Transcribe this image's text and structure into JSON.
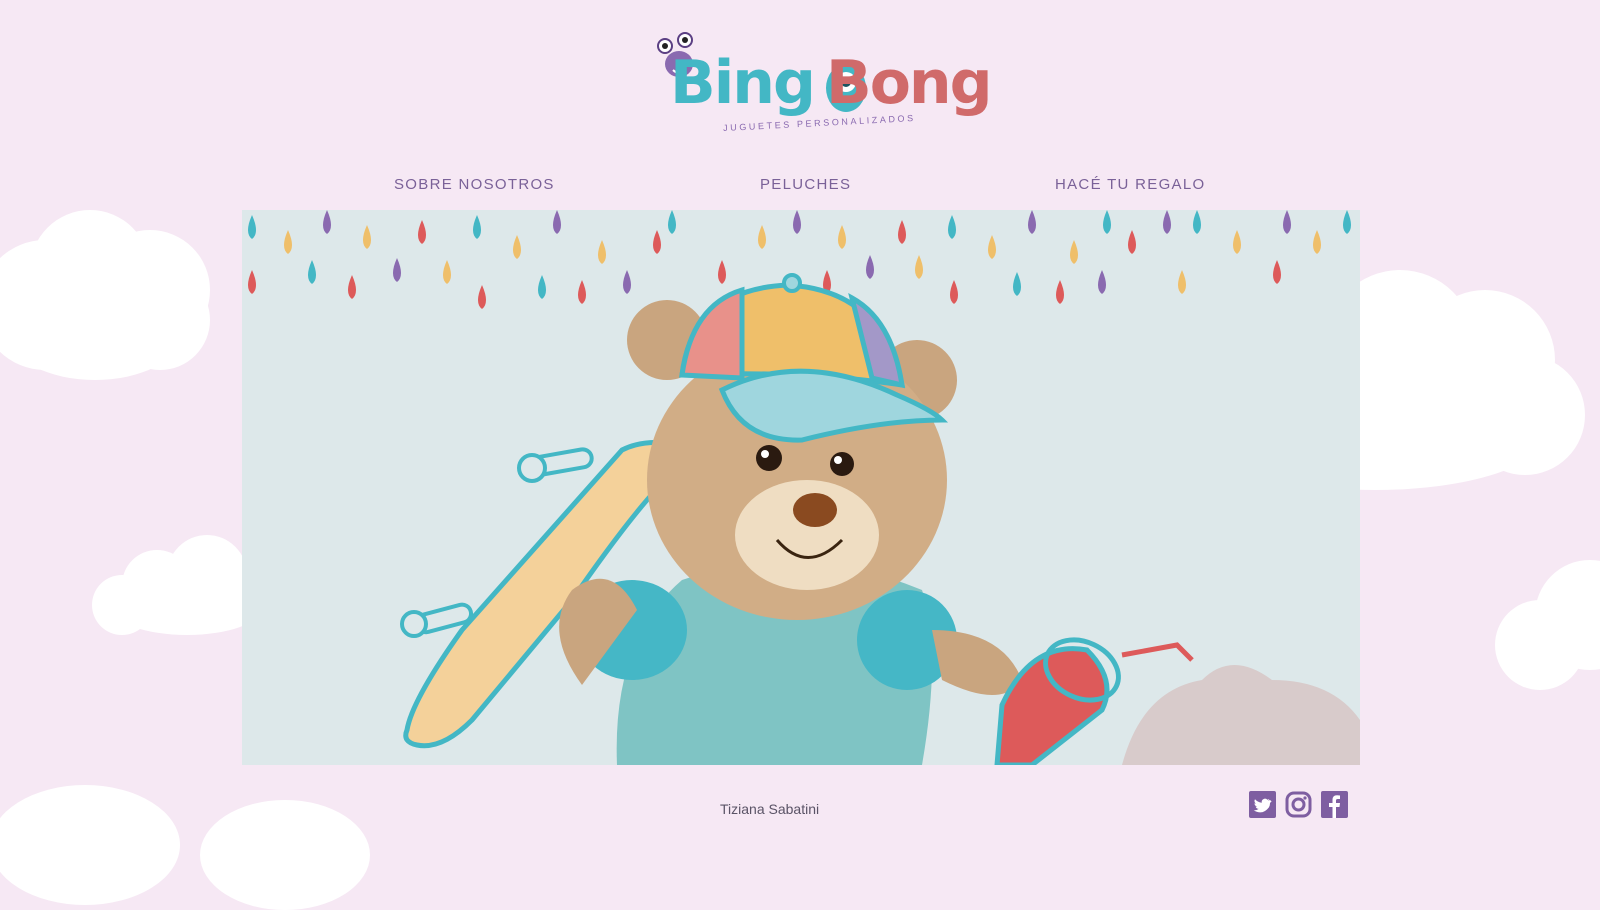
{
  "brand": {
    "name_part1": "Bing",
    "name_part2": "Bong",
    "tagline": "JUGUETES PERSONALIZADOS"
  },
  "nav": {
    "items": [
      {
        "label": "SOBRE NOSOTROS"
      },
      {
        "label": "PELUCHES"
      },
      {
        "label": "HACÉ TU REGALO"
      }
    ]
  },
  "hero": {
    "alt": "Teddy bear with cap, skateboard and drink"
  },
  "footer": {
    "credit": "Tiziana Sabatini",
    "social": [
      {
        "icon": "twitter-icon"
      },
      {
        "icon": "instagram-icon"
      },
      {
        "icon": "facebook-icon"
      }
    ]
  },
  "colors": {
    "page_bg": "#f6e8f4",
    "accent": "#7e5ea1",
    "teal": "#43b7c5",
    "coral": "#dd5a5a",
    "yellow": "#efbf6a"
  }
}
